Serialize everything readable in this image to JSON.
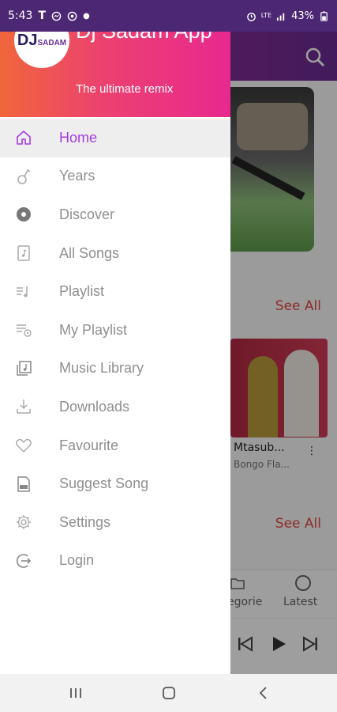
{
  "status_bar": {
    "time": "5:43",
    "carrier_glyph": "T",
    "battery": "43%",
    "icons": [
      "t-mobile-icon",
      "messenger-icon",
      "whatsapp-icon",
      "dot-icon",
      "alarm-icon",
      "lte-icon",
      "signal-icon",
      "battery-icon"
    ]
  },
  "drawer": {
    "logo_text": "DJ",
    "logo_sub": "SADAM",
    "app_title": "Dj Sadam App",
    "tagline": "The ultimate remix",
    "menu": [
      {
        "label": "Home",
        "icon": "home-icon",
        "active": true
      },
      {
        "label": "Years",
        "icon": "years-icon",
        "active": false
      },
      {
        "label": "Discover",
        "icon": "discover-icon",
        "active": false
      },
      {
        "label": "All Songs",
        "icon": "all-songs-icon",
        "active": false
      },
      {
        "label": "Playlist",
        "icon": "playlist-icon",
        "active": false
      },
      {
        "label": "My Playlist",
        "icon": "my-playlist-icon",
        "active": false
      },
      {
        "label": "Music Library",
        "icon": "music-library-icon",
        "active": false
      },
      {
        "label": "Downloads",
        "icon": "downloads-icon",
        "active": false
      },
      {
        "label": "Favourite",
        "icon": "heart-icon",
        "active": false
      },
      {
        "label": "Suggest Song",
        "icon": "suggest-song-icon",
        "active": false
      },
      {
        "label": "Settings",
        "icon": "gear-icon",
        "active": false
      },
      {
        "label": "Login",
        "icon": "login-icon",
        "active": false
      }
    ],
    "colors": {
      "active": "#a43de0",
      "inactive": "#8f8f8f",
      "header_start": "#f0663b",
      "header_end": "#e8288f"
    }
  },
  "background": {
    "see_all_1": "See All",
    "see_all_2": "See All",
    "album_title": "Mtasub...",
    "album_subtitle": "Bongo Fla...",
    "more_glyph": "⋮",
    "hero_chevron": "›",
    "tab_category": "egorie",
    "tab_latest": "Latest"
  },
  "nav_bar": {
    "icons": [
      "recent-apps-icon",
      "home-button-icon",
      "back-icon"
    ]
  }
}
